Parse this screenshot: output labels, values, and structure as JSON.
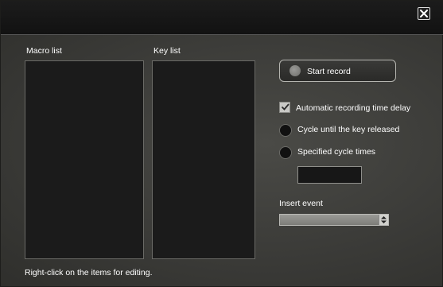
{
  "window": {
    "close_icon": "close-icon"
  },
  "macro_list": {
    "label": "Macro list",
    "items": []
  },
  "key_list": {
    "label": "Key list",
    "items": []
  },
  "record": {
    "label": "Start record",
    "icon": "record-dot-icon"
  },
  "options": {
    "auto_delay": {
      "label": "Automatic recording time delay",
      "checked": true
    },
    "cycle_until_release": {
      "label": "Cycle until the key released",
      "selected": false
    },
    "specified_cycles": {
      "label": "Specified cycle times",
      "selected": false
    },
    "cycle_times_value": ""
  },
  "insert_event": {
    "label": "Insert event",
    "value": ""
  },
  "hint": "Right-click on the items for editing."
}
